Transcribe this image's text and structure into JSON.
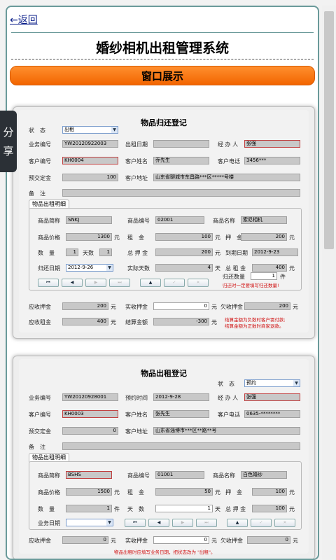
{
  "nav": {
    "back": "←返回"
  },
  "header": {
    "title": "婚纱相机出租管理系统",
    "section": "窗口展示"
  },
  "share": {
    "chars": [
      "分",
      "享"
    ]
  },
  "ret": {
    "title": "物品归还登记",
    "status_label": "状　态",
    "status_value": "出租",
    "biz_no_label": "业务编号",
    "biz_no": "YW20120922003",
    "rent_date_label": "出租日期",
    "rent_date": "",
    "handler_label": "经 办 人",
    "handler": "张强",
    "cust_no_label": "客户编号",
    "cust_no": "KH0004",
    "cust_name_label": "客户姓名",
    "cust_name": "乔先生",
    "cust_phone_label": "客户电话",
    "cust_phone": "3456***",
    "prepay_label": "预交定金",
    "prepay": "100",
    "cust_addr_label": "客户地址",
    "cust_addr": "山东省聊城市东昌路***区*****号楼",
    "remark_label": "备　注",
    "remark": "",
    "tab": "物品出租明细",
    "item_short_label": "商品简称",
    "item_short": "SNKJ",
    "item_no_label": "商品编号",
    "item_no": "02001",
    "item_name_label": "商品名称",
    "item_name": "索尼相机",
    "price_label": "商品价格",
    "price": "1300",
    "rent_label": "租　金",
    "rent": "100",
    "deposit_label": "押　金",
    "deposit": "200",
    "qty_label": "数　量",
    "qty": "1",
    "days_label": "天数",
    "days": "1",
    "total_deposit_label": "总 押 金",
    "total_deposit": "200",
    "due_label": "到期日期",
    "due": "2012-9-23",
    "return_date_label": "归还日期",
    "return_date": "2012-9-26",
    "actual_days_label": "实际天数",
    "actual_days": "4",
    "total_rent_label": "总 租 金",
    "total_rent": "400",
    "return_qty_label": "归还数量",
    "return_qty": "1",
    "return_qty_unit": "件",
    "return_note": "归还时一定要填写归还数量!",
    "due_deposit_label": "应收押金",
    "due_deposit": "200",
    "recv_deposit_label": "实收押金",
    "recv_deposit": "0",
    "owe_deposit_label": "欠收押金",
    "owe_deposit": "200",
    "due_rent_label": "应收租金",
    "due_rent": "400",
    "settle_label": "结算金额",
    "settle": "-300",
    "settle_note1": "结算金额为负数时客户需付款;",
    "settle_note2": "结算金额为正数时商家退款。",
    "unit_yuan": "元",
    "unit_day": "天",
    "unit_piece": "件"
  },
  "rent": {
    "title": "物品出租登记",
    "status_label": "状　态",
    "status_value": "预约",
    "biz_no_label": "业务编号",
    "biz_no": "YW20120928001",
    "book_time_label": "预约时间",
    "book_time": "2012-9-28",
    "handler_label": "经 办 人",
    "handler": "张强",
    "cust_no_label": "客户编号",
    "cust_no": "KH0003",
    "cust_name_label": "客户姓名",
    "cust_name": "张先生",
    "cust_phone_label": "客户电话",
    "cust_phone": "0635-********",
    "prepay_label": "预交定金",
    "prepay": "0",
    "cust_addr_label": "客户地址",
    "cust_addr": "山东省淄博市***区**路**号",
    "remark_label": "备　注",
    "remark": "",
    "tab": "物品出租明细",
    "item_short_label": "商品简称",
    "item_short": "BSHS",
    "item_no_label": "商品编号",
    "item_no": "01001",
    "item_name_label": "商品名称",
    "item_name": "白色婚纱",
    "price_label": "商品价格",
    "price": "1500",
    "rent_label": "租　金",
    "rent": "50",
    "deposit_label": "押　金",
    "deposit": "100",
    "qty_label": "数　量",
    "qty": "1",
    "days_label": "天　数",
    "days": "1",
    "total_deposit_label": "总 押 金",
    "total_deposit": "100",
    "biz_date_label": "业务日期",
    "biz_date": "",
    "due_deposit_label": "应收押金",
    "due_deposit": "0",
    "recv_deposit_label": "实收押金",
    "recv_deposit": "0",
    "owe_deposit_label": "欠收押金",
    "owe_deposit": "0",
    "bottom_note": "物品出租时应填写业务日期，把状态改为 \"出租\"。",
    "unit_yuan": "元",
    "unit_day": "天",
    "unit_piece": "件"
  },
  "nav_buttons": [
    "⏮",
    "◀",
    "▶",
    "⏭",
    "▲",
    "✓",
    "✕"
  ]
}
